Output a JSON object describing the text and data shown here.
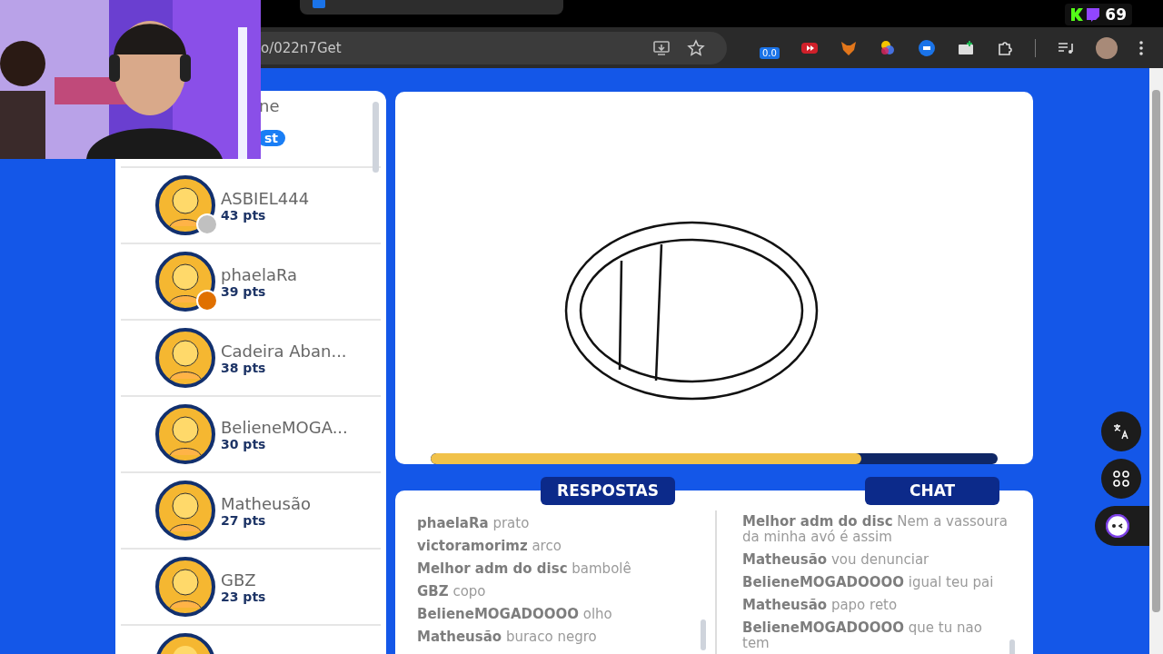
{
  "browser": {
    "address": "o/022n7Get",
    "extension_badge": "0.0"
  },
  "overlay": {
    "viewer_count": "69"
  },
  "players": [
    {
      "name": "ne",
      "badge": "st"
    },
    {
      "name": "ASBIEL444",
      "points": "43 pts",
      "color": "#c0c0c0"
    },
    {
      "name": "phaelaRa",
      "points": "39 pts",
      "color": "#e07000"
    },
    {
      "name": "Cadeira Aban...",
      "points": "38 pts"
    },
    {
      "name": "BelieneMOGA...",
      "points": "30 pts"
    },
    {
      "name": "Matheusão",
      "points": "27 pts"
    },
    {
      "name": "GBZ",
      "points": "23 pts"
    }
  ],
  "canvas": {
    "timer": {
      "level": 0.76
    }
  },
  "answers": {
    "title": "RESPOSTAS",
    "messages": [
      {
        "user": "phaelaRa",
        "text": "prato"
      },
      {
        "user": "victoramorimz",
        "text": "arco"
      },
      {
        "user": "Melhor adm do disc",
        "text": "bambolê"
      },
      {
        "user": "GBZ",
        "text": "copo"
      },
      {
        "user": "BelieneMOGADOOOO",
        "text": "olho"
      },
      {
        "user": "Matheusão",
        "text": "buraco negro"
      }
    ]
  },
  "chat": {
    "title": "CHAT",
    "messages": [
      {
        "user": "Melhor adm do disc",
        "text": "Nem a vassoura da minha avó é assim"
      },
      {
        "user": "Matheusão",
        "text": "vou denunciar"
      },
      {
        "user": "BelieneMOGADOOOO",
        "text": "igual teu pai"
      },
      {
        "user": "Matheusão",
        "text": "papo reto"
      },
      {
        "user": "BelieneMOGADOOOO",
        "text": "que tu nao tem"
      }
    ]
  }
}
